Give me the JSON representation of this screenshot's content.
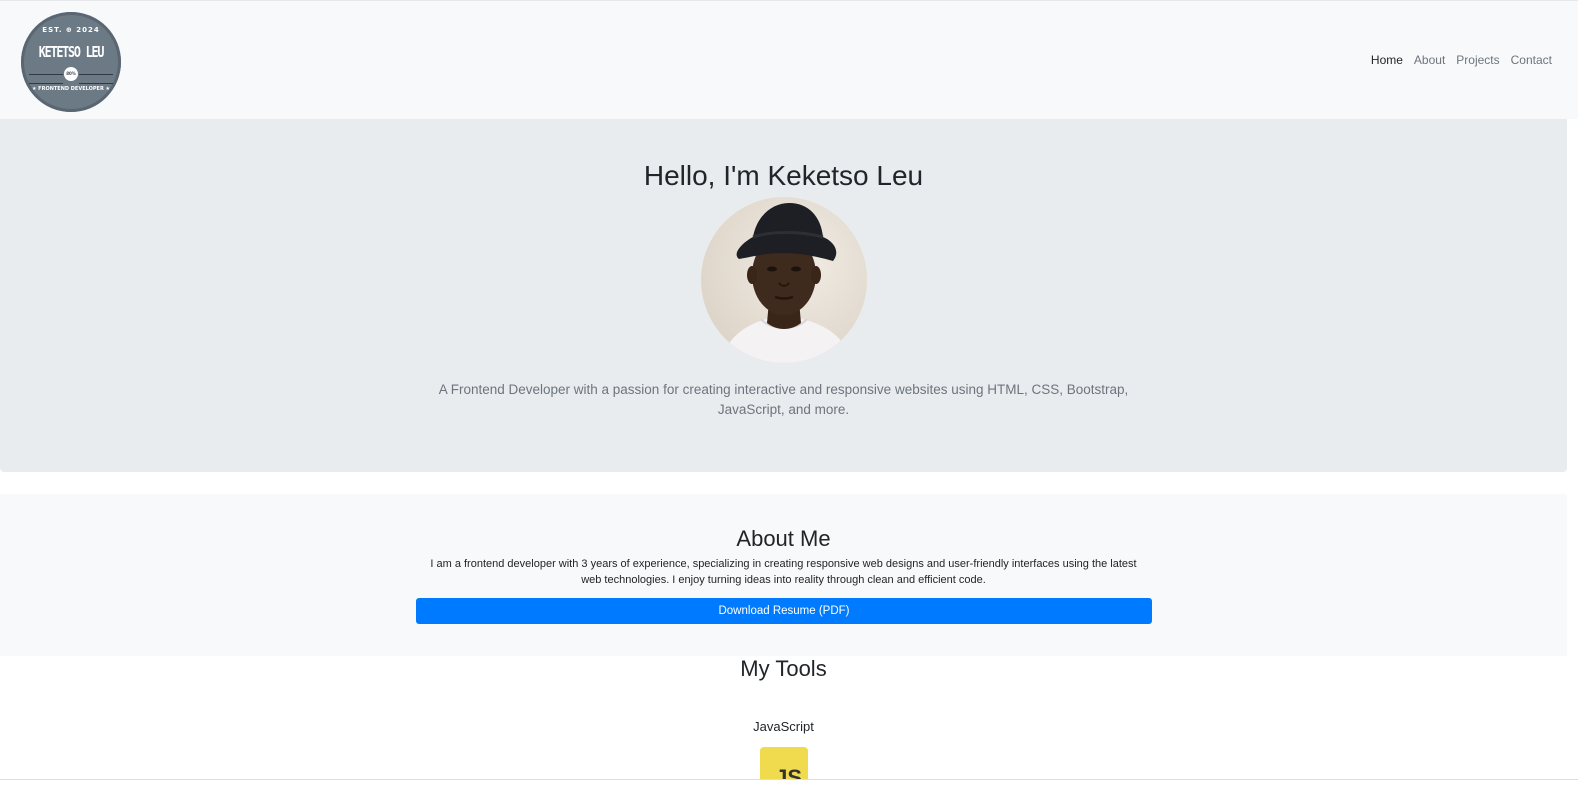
{
  "logo": {
    "est": "EST. ⊕ 2024",
    "name": "KETETSO LEU",
    "badge": "80%",
    "subtitle": "★ FRONTEND DEVELOPER ★"
  },
  "nav": {
    "items": [
      {
        "label": "Home",
        "active": true
      },
      {
        "label": "About",
        "active": false
      },
      {
        "label": "Projects",
        "active": false
      },
      {
        "label": "Contact",
        "active": false
      }
    ]
  },
  "hero": {
    "title": "Hello, I'm Keketso Leu",
    "text": "A Frontend Developer with a passion for creating interactive and responsive websites using HTML, CSS, Bootstrap, JavaScript, and more."
  },
  "about": {
    "title": "About Me",
    "text": "I am a frontend developer with 3 years of experience, specializing in creating responsive web designs and user-friendly interfaces using the latest web technologies. I enjoy turning ideas into reality through clean and efficient code.",
    "button_label": "Download Resume (PDF)"
  },
  "tools": {
    "title": "My Tools",
    "items": [
      {
        "name": "JavaScript",
        "icon_text": "JS",
        "icon": "javascript-logo-icon"
      }
    ]
  },
  "colors": {
    "primary": "#007bff",
    "navbar_bg": "#f8f9fa",
    "hero_bg": "#e9ecef",
    "js_yellow": "#f0db4f"
  }
}
